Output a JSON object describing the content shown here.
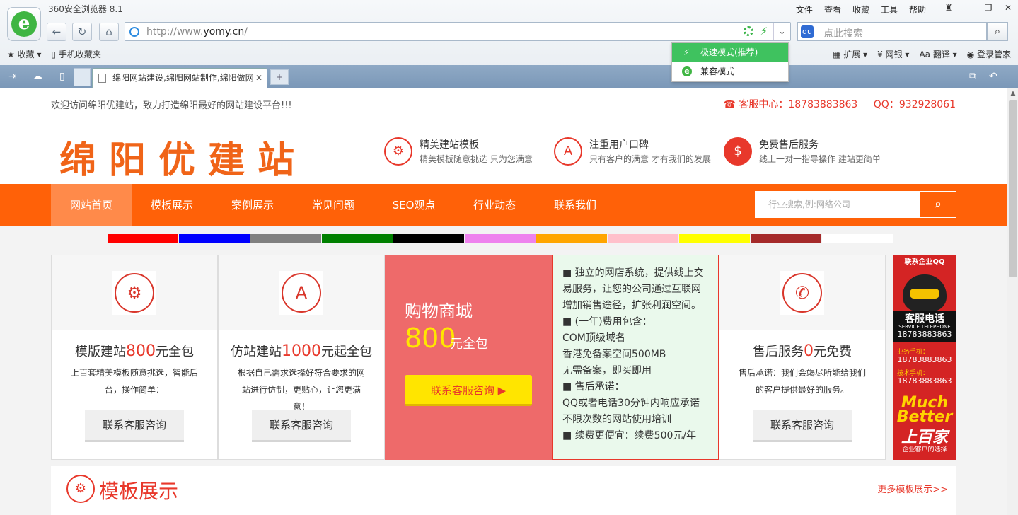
{
  "browser": {
    "title": "360安全浏览器 8.1",
    "menus": [
      "文件",
      "查看",
      "收藏",
      "工具",
      "帮助"
    ],
    "url_prefix": "http://www.",
    "url_domain": "yomy.cn",
    "url_suffix": "/",
    "search_placeholder": "点此搜索",
    "bookmarks_left": [
      "收藏",
      "手机收藏夹"
    ],
    "bookmarks_right": [
      "扩展",
      "网银",
      "翻译",
      "登录管家"
    ],
    "tab_title": "绵阳网站建设,绵阳网站制作,绵阳做网",
    "mode_popup": [
      "极速模式(推荐)",
      "兼容模式"
    ]
  },
  "site": {
    "welcome": "欢迎访问绵阳优建站，致力打造绵阳最好的网站建设平台!!!",
    "phone_label": "客服中心：18783883863",
    "qq_label": "QQ：932928061",
    "brand": "绵阳优建站",
    "features": [
      {
        "title": "精美建站模板",
        "sub": "精美模板随意挑选 只为您满意",
        "icon": "gear-icon"
      },
      {
        "title": "注重用户口碑",
        "sub": "只有客户的满意 才有我们的发展",
        "icon": "app-icon"
      },
      {
        "title": "免费售后服务",
        "sub": "线上一对一指导操作 建站更简单",
        "icon": "money-bag-icon"
      }
    ],
    "nav": [
      "网站首页",
      "模板展示",
      "案例展示",
      "常见问题",
      "SEO观点",
      "行业动态",
      "联系我们"
    ],
    "search_placeholder": "行业搜索,例:网络公司",
    "color_swatches": [
      "#ff0000",
      "#0000ff",
      "#808080",
      "#008000",
      "#000000",
      "#ee82ee",
      "#ffa500",
      "#ffc0cb",
      "#ffff00",
      "#a52a2a",
      "#ffffff"
    ],
    "cards": [
      {
        "pre": "模版建站",
        "price": "800",
        "post": "元全包",
        "desc": "上百套精美模板随意挑选，智能后台，操作简单：",
        "button": "联系客服咨询"
      },
      {
        "pre": "仿站建站",
        "price": "1000",
        "post": "元起全包",
        "desc": "根据自己需求选择好符合要求的网站进行仿制，更贴心，让您更满意！",
        "button": "联系客服咨询"
      },
      {
        "pre": "售后服务",
        "price": "0",
        "post": "元免费",
        "desc": "售后承诺：我们会竭尽所能给我们的客户提供最好的服务。",
        "button": "联系客服咨询"
      }
    ],
    "shop": {
      "title": "购物商城",
      "price": "800",
      "unit": "元全包",
      "button": "联系客服咨询"
    },
    "shop_details": [
      "■ 独立的网店系统，提供线上交",
      "易服务，让您的公司通过互联网",
      "增加销售途径，扩张利润空间。",
      "■ (一年)费用包含：",
      "COM顶级域名",
      "香港免备案空间500MB",
      "无需备案，即买即用",
      "■ 售后承诺：",
      "QQ或者电话30分钟内响应承诺",
      "不限次数的网站使用培训",
      "■ 续费更便宜：续费500元/年"
    ],
    "qq_ad": {
      "header": "联系企业QQ",
      "service": "客服电话",
      "service_en": "SERVICE TELEPHONE",
      "phone1": "18783883863",
      "biz_label": "业务手机：",
      "phone2": "18783883863",
      "tech_label": "技术手机：",
      "phone3": "18783883863",
      "much": "Much",
      "better": "Better",
      "big": "上百家",
      "tag": "企业客户的选择"
    },
    "showcase": {
      "title": "模板展示",
      "more": "更多模板展示>>"
    }
  }
}
